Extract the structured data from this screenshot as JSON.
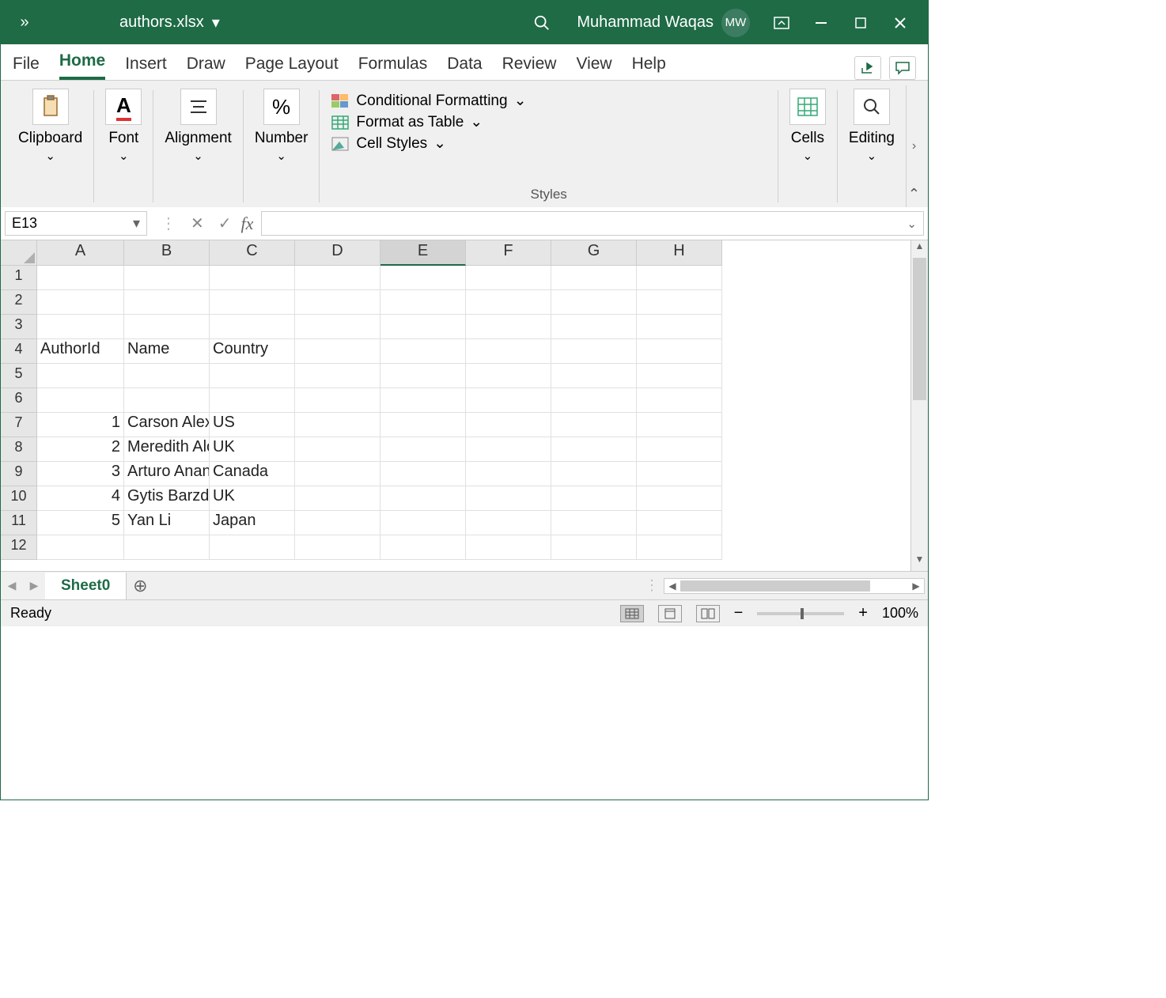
{
  "titlebar": {
    "filename": "authors.xlsx",
    "user_name": "Muhammad Waqas",
    "user_initials": "MW"
  },
  "tabs": {
    "file": "File",
    "home": "Home",
    "insert": "Insert",
    "draw": "Draw",
    "page_layout": "Page Layout",
    "formulas": "Formulas",
    "data": "Data",
    "review": "Review",
    "view": "View",
    "help": "Help"
  },
  "ribbon": {
    "clipboard": "Clipboard",
    "font": "Font",
    "alignment": "Alignment",
    "number": "Number",
    "cond_fmt": "Conditional Formatting",
    "fmt_table": "Format as Table",
    "cell_styles": "Cell Styles",
    "styles": "Styles",
    "cells": "Cells",
    "editing": "Editing"
  },
  "namebox": "E13",
  "columns": [
    "A",
    "B",
    "C",
    "D",
    "E",
    "F",
    "G",
    "H"
  ],
  "rows": [
    "1",
    "2",
    "3",
    "4",
    "5",
    "6",
    "7",
    "8",
    "9",
    "10",
    "11",
    "12"
  ],
  "selected_col": "E",
  "cells": {
    "A4": "AuthorId",
    "B4": "Name",
    "C4": "Country",
    "A7": "1",
    "B7": "Carson Alexander",
    "C7": "US",
    "A8": "2",
    "B8": "Meredith Alonso",
    "C8": "UK",
    "A9": "3",
    "B9": "Arturo Anand",
    "C9": "Canada",
    "A10": "4",
    "B10": "Gytis Barzdukas",
    "C10": "UK",
    "A11": "5",
    "B11": "Yan Li",
    "C11": "Japan"
  },
  "chart_data": {
    "type": "table",
    "headers": [
      "AuthorId",
      "Name",
      "Country"
    ],
    "rows": [
      [
        1,
        "Carson Alexander",
        "US"
      ],
      [
        2,
        "Meredith Alonso",
        "UK"
      ],
      [
        3,
        "Arturo Anand",
        "Canada"
      ],
      [
        4,
        "Gytis Barzdukas",
        "UK"
      ],
      [
        5,
        "Yan Li",
        "Japan"
      ]
    ]
  },
  "sheet_tab": "Sheet0",
  "status": {
    "ready": "Ready",
    "zoom": "100%"
  }
}
